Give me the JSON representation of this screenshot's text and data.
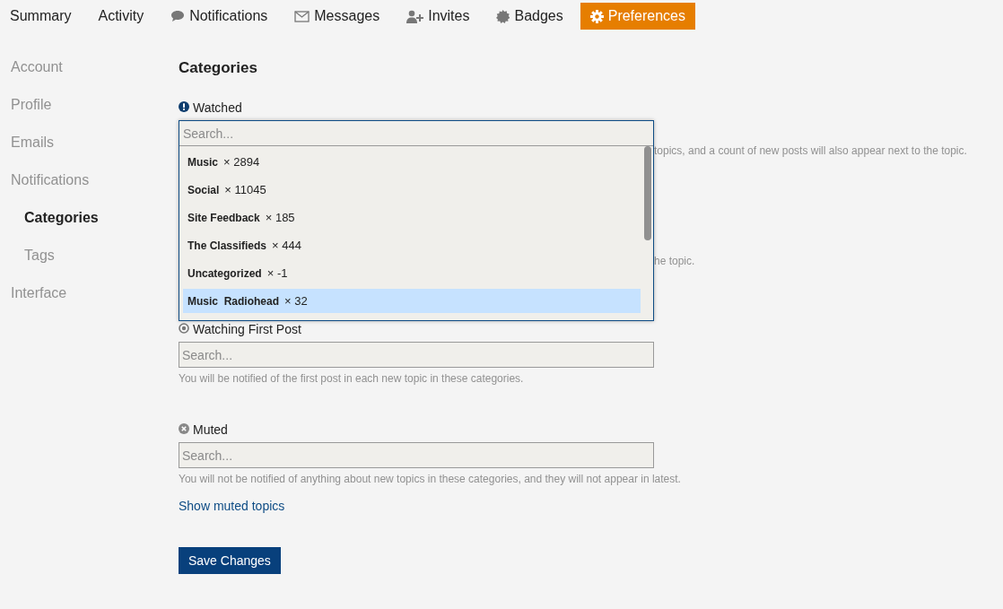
{
  "tabs": [
    {
      "label": "Summary",
      "selected": false
    },
    {
      "label": "Activity",
      "selected": false
    },
    {
      "label": "Notifications",
      "selected": false
    },
    {
      "label": "Messages",
      "selected": false
    },
    {
      "label": "Invites",
      "selected": false
    },
    {
      "label": "Badges",
      "selected": false
    },
    {
      "label": "Preferences",
      "selected": true
    }
  ],
  "sidebar": {
    "items": [
      {
        "label": "Account",
        "selected": false
      },
      {
        "label": "Profile",
        "selected": false
      },
      {
        "label": "Emails",
        "selected": false
      },
      {
        "label": "Notifications",
        "selected": false,
        "children": [
          {
            "label": "Categories",
            "selected": true
          },
          {
            "label": "Tags",
            "selected": false
          }
        ]
      },
      {
        "label": "Interface",
        "selected": false
      }
    ]
  },
  "title": "Categories",
  "hidden_fragments": [
    "topics, and a count of new posts will also appear next to the topic.",
    "he topic."
  ],
  "watched": {
    "label": "Watched",
    "dropdown": {
      "placeholder": "Search...",
      "options": [
        {
          "name": "Music",
          "count": "× 2894",
          "selected": false
        },
        {
          "name": "Social",
          "count": "× 11045",
          "selected": false
        },
        {
          "name": "Site Feedback",
          "count": "× 185",
          "selected": false
        },
        {
          "name": "The Classifieds",
          "count": "× 444",
          "selected": false
        },
        {
          "name": "Uncategorized",
          "count": "× -1",
          "selected": false
        },
        {
          "name": "Music  Radiohead",
          "count": "× 32",
          "selected": true
        }
      ]
    }
  },
  "sections": [
    {
      "label": "Watching First Post",
      "placeholder": "Search...",
      "description": "You will be notified of the first post in each new topic in these categories."
    },
    {
      "label": "Muted",
      "placeholder": "Search...",
      "description": "You will not be notified of anything about new topics in these categories, and they will not appear in latest."
    }
  ],
  "link": "Show muted topics",
  "save_button": "Save Changes"
}
